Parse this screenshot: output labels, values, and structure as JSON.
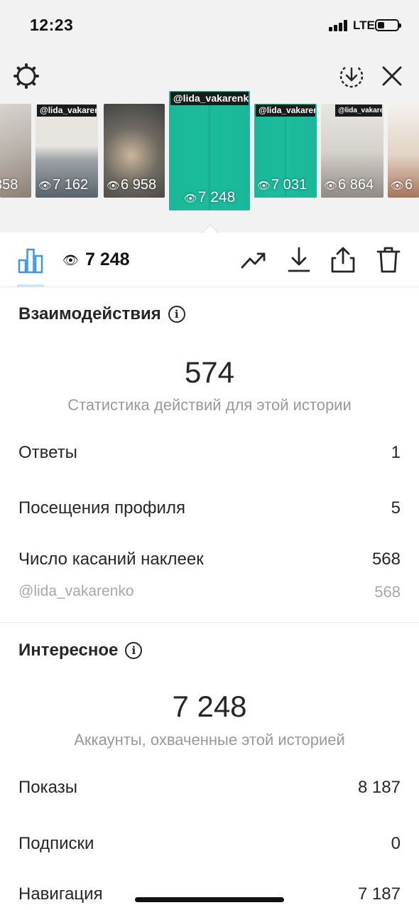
{
  "status_bar": {
    "time": "12:23",
    "network": "LTE"
  },
  "colors": {
    "accent_teal": "#1abc9c",
    "selected_tab_blue": "#3897f0",
    "muted_gray": "#999999"
  },
  "top_bar": {
    "settings_icon": "gear-icon",
    "download_icon": "download-circle-icon",
    "close_icon": "close-icon"
  },
  "stories": [
    {
      "handle": "",
      "views": "358"
    },
    {
      "handle": "@lida_vakarenko",
      "views": "7 162"
    },
    {
      "handle": "",
      "views": "6 958"
    },
    {
      "handle": "@lida_vakarenko",
      "views": "7 248",
      "selected": true
    },
    {
      "handle": "@lida_vakarenko",
      "views": "7 031"
    },
    {
      "handle": "@lida_vakarenko",
      "views": "6 864"
    },
    {
      "handle": "",
      "views": "6"
    }
  ],
  "toolbar": {
    "views": "7 248",
    "icons": [
      "bar-chart-icon",
      "trending-icon",
      "download-icon",
      "share-icon",
      "trash-icon"
    ]
  },
  "interactions": {
    "title": "Взаимодействия",
    "total": "574",
    "subtitle": "Статистика действий для этой истории",
    "rows": [
      {
        "label": "Ответы",
        "value": "1"
      },
      {
        "label": "Посещения профиля",
        "value": "5"
      },
      {
        "label": "Число касаний наклеек",
        "value": "568"
      }
    ],
    "sticker_sub": {
      "label": "@lida_vakarenko",
      "value": "568"
    }
  },
  "discovery": {
    "title": "Интересное",
    "total": "7 248",
    "subtitle": "Аккаунты, охваченные этой историей",
    "rows": [
      {
        "label": "Показы",
        "value": "8 187"
      },
      {
        "label": "Подписки",
        "value": "0"
      },
      {
        "label": "Навигация",
        "value": "7 187"
      }
    ]
  }
}
